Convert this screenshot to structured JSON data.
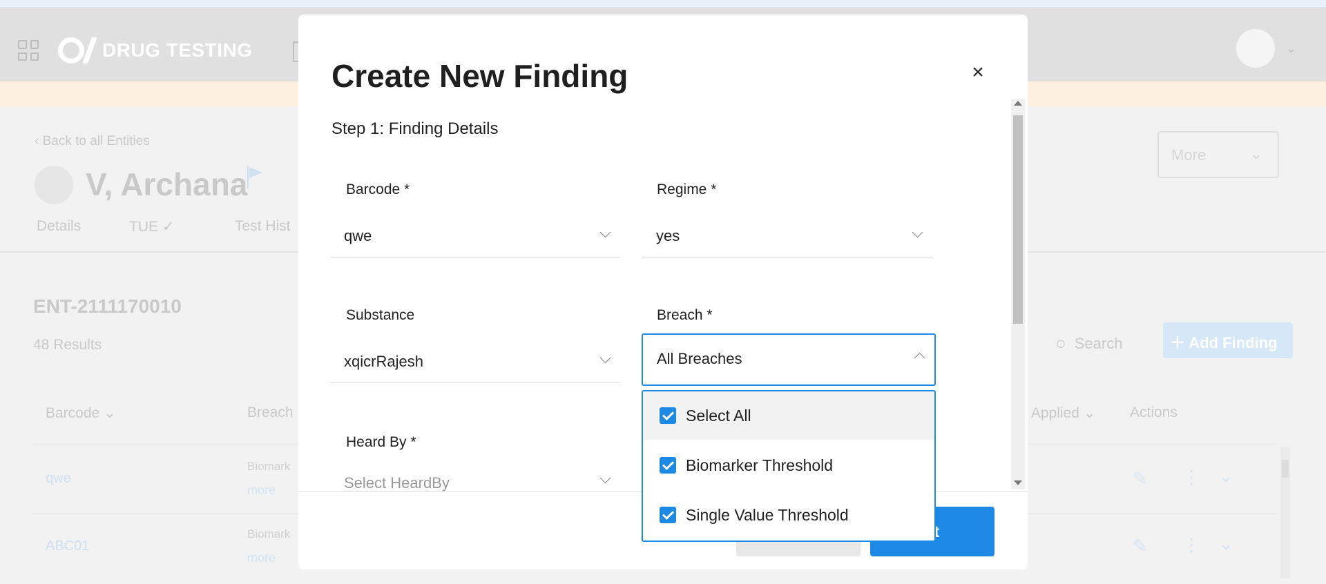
{
  "app": {
    "title": "DRUG TESTING"
  },
  "background": {
    "back_link": "Back to all Entities",
    "entity_name": "V, Archana",
    "tabs": [
      "Details",
      "TUE",
      "Test Hist"
    ],
    "entity_id": "ENT-2111170010",
    "results_count": "48 Results",
    "more_button": "More",
    "search_label": "Search",
    "add_finding_button": "Add Finding",
    "columns": [
      "Barcode",
      "Breach",
      "ns Applied",
      "Actions"
    ],
    "rows": [
      {
        "barcode": "qwe",
        "breach": "Biomark",
        "more": "more"
      },
      {
        "barcode": "ABC01",
        "breach": "Biomark",
        "more": "more"
      }
    ]
  },
  "dialog": {
    "title": "Create New Finding",
    "close_glyph": "×",
    "step": "Step 1: Finding Details",
    "fields": {
      "barcode": {
        "label": "Barcode *",
        "value": "qwe"
      },
      "regime": {
        "label": "Regime *",
        "value": "yes"
      },
      "substance": {
        "label": "Substance",
        "value": "xqicrRajesh"
      },
      "breach": {
        "label": "Breach *",
        "value": "All Breaches"
      },
      "heard_by": {
        "label": "Heard By *",
        "placeholder": "Select HeardBy"
      }
    },
    "breach_options": [
      {
        "label": "Select All",
        "checked": true
      },
      {
        "label": "Biomarker Threshold",
        "checked": true
      },
      {
        "label": "Single Value Threshold",
        "checked": true
      }
    ],
    "next_button": "Next",
    "next_visible_text": "xt"
  },
  "colors": {
    "accent": "#1e88e5",
    "header_bg": "#e0e0e0",
    "banner_bg": "#fbf1de"
  }
}
